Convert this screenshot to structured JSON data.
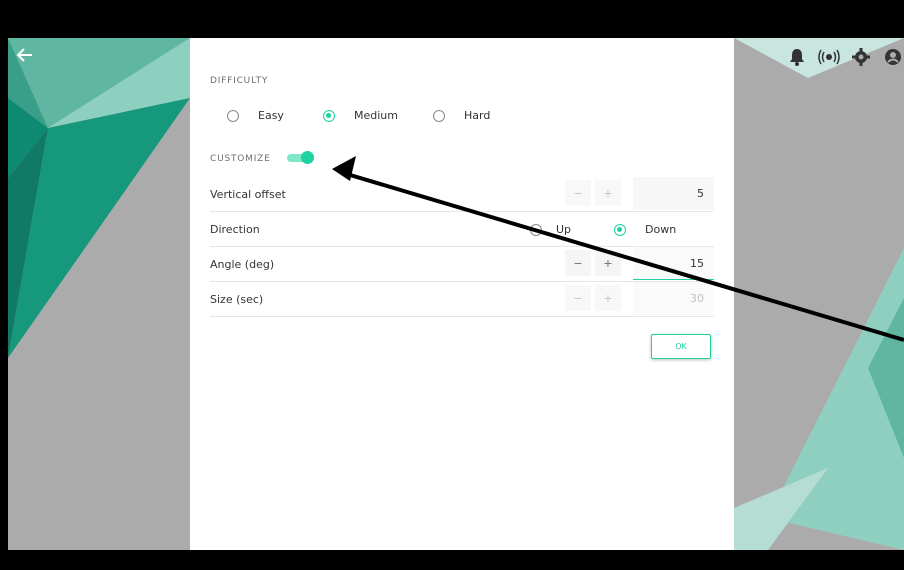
{
  "colors": {
    "accent": "#1fd2a2",
    "background": "#ababab",
    "teal_dark": "#0f8a72"
  },
  "header": {
    "back_icon": "arrow-left-icon",
    "right_icons": [
      "bell-icon",
      "broadcast-icon",
      "gear-icon",
      "account-icon"
    ]
  },
  "difficulty": {
    "label": "DIFFICULTY",
    "options": [
      {
        "label": "Easy",
        "checked": false
      },
      {
        "label": "Medium",
        "checked": true
      },
      {
        "label": "Hard",
        "checked": false
      }
    ]
  },
  "customize": {
    "label": "CUSTOMIZE",
    "enabled": true
  },
  "settings": {
    "vertical_offset": {
      "label": "Vertical offset",
      "minus": "−",
      "plus": "+",
      "value": "5"
    },
    "direction": {
      "label": "Direction",
      "options": [
        {
          "label": "Up",
          "checked": false
        },
        {
          "label": "Down",
          "checked": true
        }
      ]
    },
    "angle": {
      "label": "Angle (deg)",
      "minus": "−",
      "plus": "+",
      "value": "15"
    },
    "size": {
      "label": "Size (sec)",
      "minus": "−",
      "plus": "+",
      "value": "30"
    }
  },
  "ok_button": {
    "label": "OK"
  }
}
